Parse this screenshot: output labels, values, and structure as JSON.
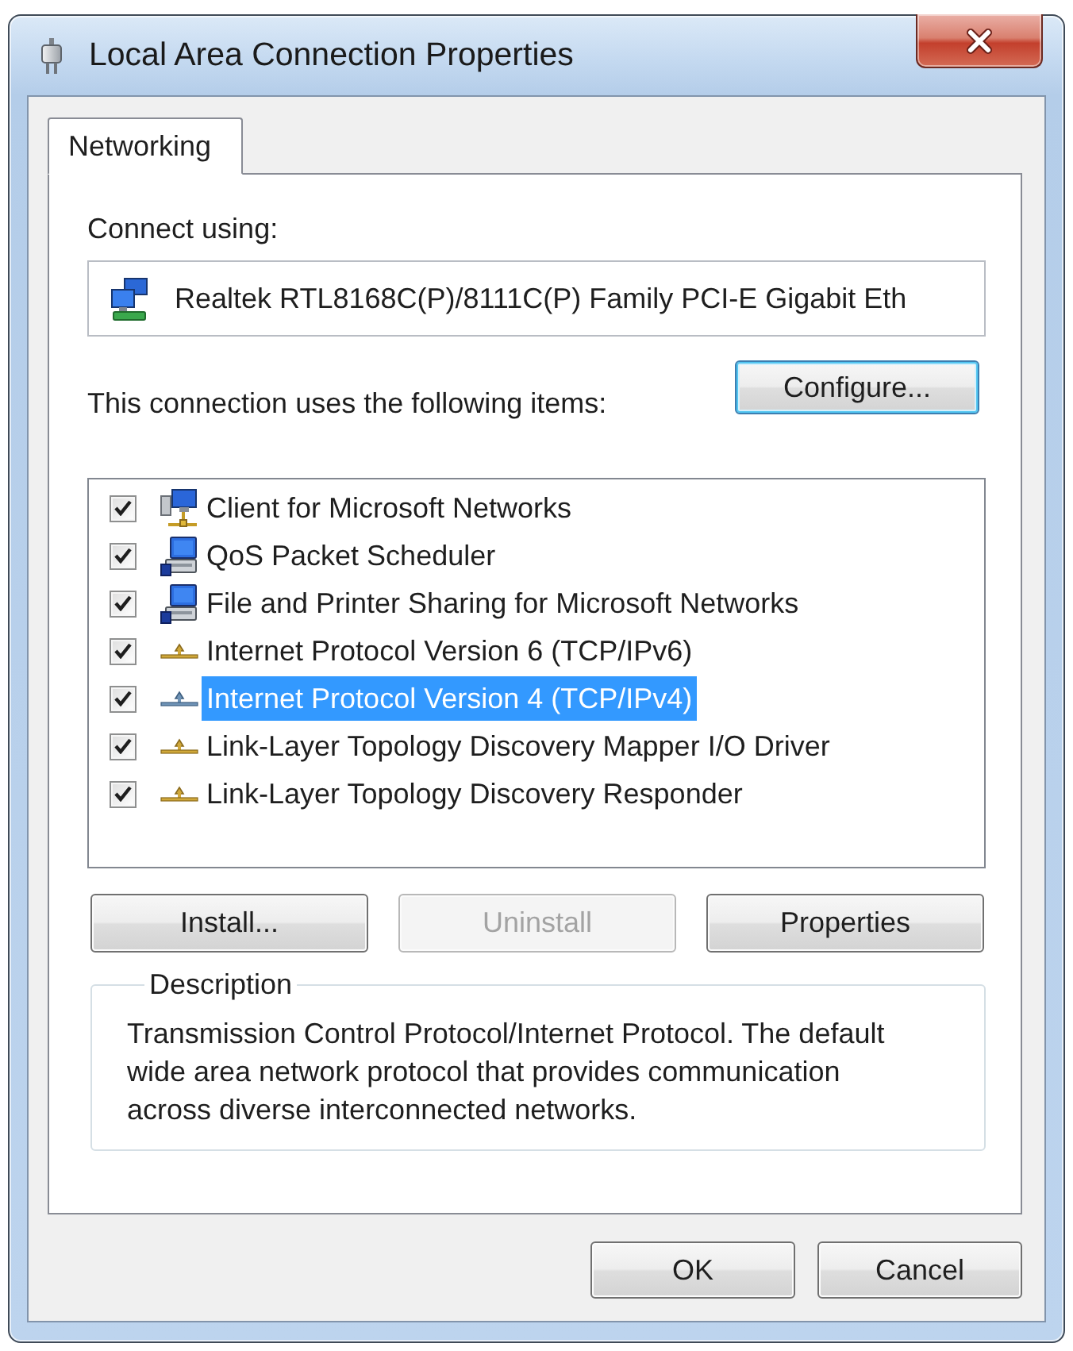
{
  "window": {
    "title": "Local Area Connection Properties"
  },
  "tabs": [
    {
      "label": "Networking",
      "selected": true
    }
  ],
  "connect_using": {
    "label": "Connect using:",
    "adapter": "Realtek RTL8168C(P)/8111C(P) Family PCI-E Gigabit Eth"
  },
  "configure_button": {
    "label": "Configure...",
    "focused": true
  },
  "items_label": "This connection uses the following items:",
  "items": [
    {
      "kind": "client",
      "label": "Client for Microsoft Networks",
      "checked": true,
      "selected": false
    },
    {
      "kind": "service",
      "label": "QoS Packet Scheduler",
      "checked": true,
      "selected": false
    },
    {
      "kind": "service",
      "label": "File and Printer Sharing for Microsoft Networks",
      "checked": true,
      "selected": false
    },
    {
      "kind": "protocol",
      "label": "Internet Protocol Version 6 (TCP/IPv6)",
      "checked": true,
      "selected": false
    },
    {
      "kind": "protocol",
      "label": "Internet Protocol Version 4 (TCP/IPv4)",
      "checked": true,
      "selected": true
    },
    {
      "kind": "protocol",
      "label": "Link-Layer Topology Discovery Mapper I/O Driver",
      "checked": true,
      "selected": false
    },
    {
      "kind": "protocol",
      "label": "Link-Layer Topology Discovery Responder",
      "checked": true,
      "selected": false
    }
  ],
  "item_buttons": [
    {
      "label": "Install...",
      "disabled": false
    },
    {
      "label": "Uninstall",
      "disabled": true
    },
    {
      "label": "Properties",
      "disabled": false
    }
  ],
  "description": {
    "title": "Description",
    "text": "Transmission Control Protocol/Internet Protocol. The default wide area network protocol that provides communication across diverse interconnected networks."
  },
  "dialog_buttons": [
    {
      "label": "OK"
    },
    {
      "label": "Cancel"
    }
  ]
}
